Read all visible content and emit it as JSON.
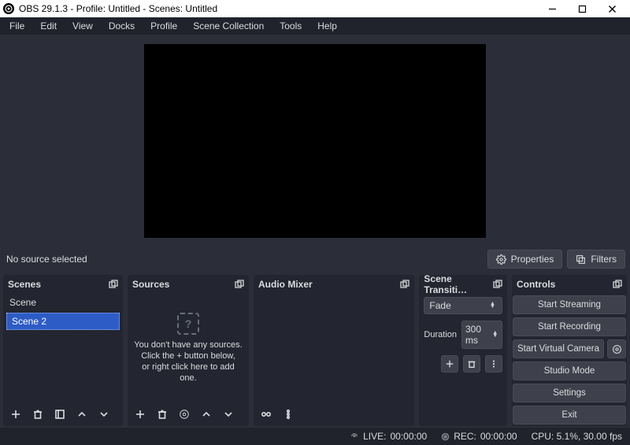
{
  "window": {
    "title": "OBS 29.1.3 - Profile: Untitled - Scenes: Untitled"
  },
  "menu": [
    "File",
    "Edit",
    "View",
    "Docks",
    "Profile",
    "Scene Collection",
    "Tools",
    "Help"
  ],
  "context": {
    "no_source": "No source selected",
    "properties": "Properties",
    "filters": "Filters"
  },
  "docks": {
    "scenes": {
      "title": "Scenes",
      "items": [
        "Scene",
        "Scene 2"
      ],
      "selected": 1
    },
    "sources": {
      "title": "Sources",
      "empty1": "You don't have any sources.",
      "empty2": "Click the + button below,",
      "empty3": "or right click here to add one."
    },
    "mixer": {
      "title": "Audio Mixer"
    },
    "transitions": {
      "title": "Scene Transiti…",
      "selected": "Fade",
      "duration_label": "Duration",
      "duration_value": "300 ms"
    },
    "controls": {
      "title": "Controls",
      "buttons": [
        "Start Streaming",
        "Start Recording",
        "Start Virtual Camera",
        "Studio Mode",
        "Settings",
        "Exit"
      ]
    }
  },
  "status": {
    "live_label": "LIVE:",
    "live_time": "00:00:00",
    "rec_label": "REC:",
    "rec_time": "00:00:00",
    "cpu": "CPU: 5.1%, 30.00 fps"
  }
}
